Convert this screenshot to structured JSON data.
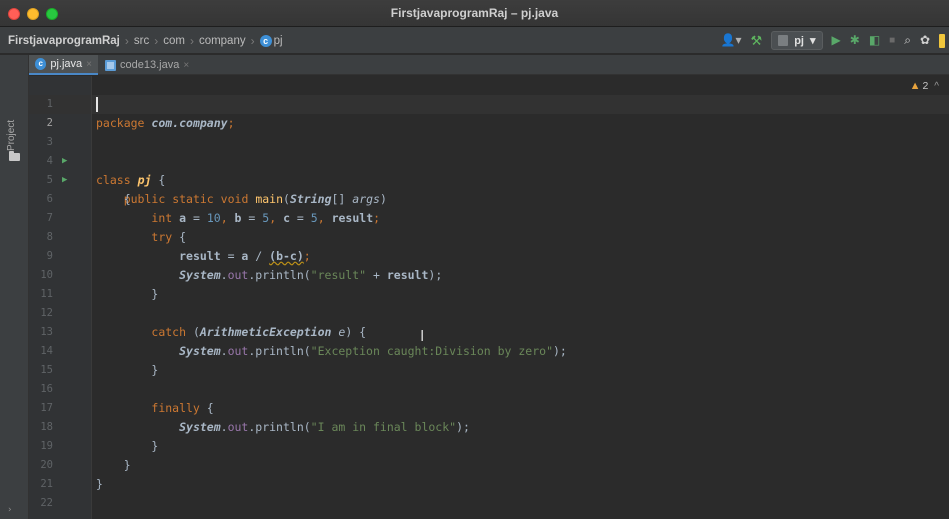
{
  "window": {
    "title": "FirstjavaprogramRaj – pj.java"
  },
  "navbar": {
    "breadcrumbs": [
      "FirstjavaprogramRaj",
      "src",
      "com",
      "company",
      "pj"
    ],
    "run_config": "pj",
    "icons": [
      "user-icon",
      "hammer-icon",
      "run-icon",
      "debug-icon",
      "coverage-icon",
      "stop-icon",
      "search-icon",
      "gear-icon",
      "toolbox-icon"
    ]
  },
  "sidebar": {
    "project_label": "Project"
  },
  "tabs": [
    {
      "label": "pj.java",
      "active": true
    },
    {
      "label": "code13.java",
      "active": false
    }
  ],
  "editor": {
    "warnings": {
      "count": "2"
    },
    "lines": [
      {
        "n": "1"
      },
      {
        "n": "2"
      },
      {
        "n": "3"
      },
      {
        "n": "4"
      },
      {
        "n": "5"
      },
      {
        "n": "6"
      },
      {
        "n": "7"
      },
      {
        "n": "8"
      },
      {
        "n": "9"
      },
      {
        "n": "10"
      },
      {
        "n": "11"
      },
      {
        "n": "12"
      },
      {
        "n": "13"
      },
      {
        "n": "14"
      },
      {
        "n": "15"
      },
      {
        "n": "16"
      },
      {
        "n": "17"
      },
      {
        "n": "18"
      },
      {
        "n": "19"
      },
      {
        "n": "20"
      },
      {
        "n": "21"
      },
      {
        "n": "22"
      }
    ],
    "code": {
      "l1_kw": "package",
      "l1_pkg": "com.company",
      "l1_semi": ";",
      "l3_kw": "class",
      "l3_name": "pj",
      "l3_brace": "{",
      "l4_kw1": "public",
      "l4_kw2": "static",
      "l4_kw3": "void",
      "l4_fn": "main",
      "l4_open": "(",
      "l4_type": "String",
      "l4_arr": "[] ",
      "l4_param": "args",
      "l4_close": ")",
      "l5_brace": "{",
      "l6_kw": "int",
      "l6_a": "a",
      "l6_eq1": " = ",
      "l6_n1": "10",
      "l6_c1": ", ",
      "l6_b": "b",
      "l6_eq2": " = ",
      "l6_n2": "5",
      "l6_c2": ", ",
      "l6_c": "c",
      "l6_eq3": " = ",
      "l6_n3": "5",
      "l6_c3": ", ",
      "l6_result": "result",
      "l6_semi": ";",
      "l7_kw": "try",
      "l7_brace": " {",
      "l8_result": "result",
      "l8_eq": " = ",
      "l8_a": "a",
      "l8_div": " / ",
      "l8_expr": "(b-c)",
      "l8_semi": ";",
      "l9_sys": "System",
      "l9_dot1": ".",
      "l9_out": "out",
      "l9_call": ".println(",
      "l9_str": "\"result\"",
      "l9_plus": " + ",
      "l9_result": "result",
      "l9_end": ");",
      "l10_brace": "}",
      "l12_kw": "catch",
      "l12_open": " (",
      "l12_type": "ArithmeticException",
      "l12_sp": " ",
      "l12_e": "e",
      "l12_close": ") {",
      "l13_sys": "System",
      "l13_dot1": ".",
      "l13_out": "out",
      "l13_call": ".println(",
      "l13_str": "\"Exception caught:Division by zero\"",
      "l13_end": ");",
      "l14_brace": "}",
      "l16_kw": "finally",
      "l16_brace": " {",
      "l17_sys": "System",
      "l17_dot1": ".",
      "l17_out": "out",
      "l17_call": ".println(",
      "l17_str": "\"I am in final block\"",
      "l17_end": ");",
      "l18_brace": "}",
      "l19_brace": "}",
      "l20_brace": "}"
    }
  }
}
